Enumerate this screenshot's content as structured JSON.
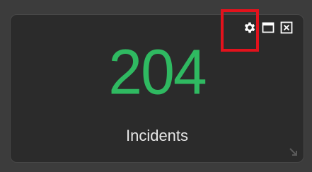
{
  "widget": {
    "value": "204",
    "label": "Incidents"
  },
  "toolbar": {
    "icons": [
      "gear-icon",
      "maximize-icon",
      "close-icon"
    ]
  },
  "colors": {
    "value_color": "#2fb961",
    "highlight_border": "#e3121c",
    "panel_background": "#2b2b2b"
  }
}
